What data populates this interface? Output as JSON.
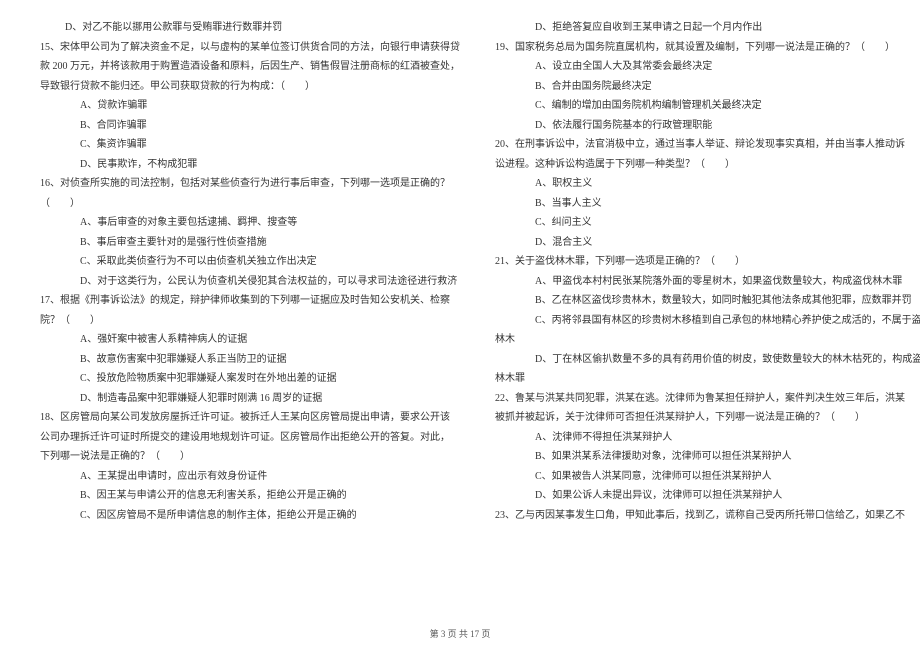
{
  "left_column": [
    {
      "cls": "indent-1",
      "text": "D、对乙不能以挪用公款罪与受贿罪进行数罪并罚"
    },
    {
      "cls": "q-continue",
      "text": "15、宋体甲公司为了解决资金不足，以与虚构的某单位签订供货合同的方法，向银行申请获得贷"
    },
    {
      "cls": "q-continue",
      "text": "款 200 万元，并将该款用于购置造酒设备和原料，后因生产、销售假冒注册商标的红酒被查处，"
    },
    {
      "cls": "q-continue",
      "text": "导致银行贷款不能归还。甲公司获取贷款的行为构成：（　　）"
    },
    {
      "cls": "indent-2",
      "text": "A、贷款诈骗罪"
    },
    {
      "cls": "indent-2",
      "text": "B、合同诈骗罪"
    },
    {
      "cls": "indent-2",
      "text": "C、集资诈骗罪"
    },
    {
      "cls": "indent-2",
      "text": "D、民事欺诈，不构成犯罪"
    },
    {
      "cls": "q-continue",
      "text": "16、对侦查所实施的司法控制，包括对某些侦查行为进行事后审查，下列哪一选项是正确的？"
    },
    {
      "cls": "q-continue",
      "text": "（　　）"
    },
    {
      "cls": "indent-2",
      "text": "A、事后审查的对象主要包括逮捕、羁押、搜查等"
    },
    {
      "cls": "indent-2",
      "text": "B、事后审查主要针对的是强行性侦查措施"
    },
    {
      "cls": "indent-2",
      "text": "C、采取此类侦查行为不可以由侦查机关独立作出决定"
    },
    {
      "cls": "indent-2",
      "text": "D、对于这类行为，公民认为侦查机关侵犯其合法权益的，可以寻求司法途径进行救济"
    },
    {
      "cls": "q-continue",
      "text": "17、根据《刑事诉讼法》的规定，辩护律师收集到的下列哪一证据应及时告知公安机关、检察"
    },
    {
      "cls": "q-continue",
      "text": "院？（　　）"
    },
    {
      "cls": "indent-2",
      "text": "A、强奸案中被害人系精神病人的证据"
    },
    {
      "cls": "indent-2",
      "text": "B、故意伤害案中犯罪嫌疑人系正当防卫的证据"
    },
    {
      "cls": "indent-2",
      "text": "C、投放危险物质案中犯罪嫌疑人案发时在外地出差的证据"
    },
    {
      "cls": "indent-2",
      "text": "D、制造毒品案中犯罪嫌疑人犯罪时刚满 16 周岁的证据"
    },
    {
      "cls": "q-continue",
      "text": "18、区房管局向某公司发放房屋拆迁许可证。被拆迁人王某向区房管局提出申请，要求公开该"
    },
    {
      "cls": "q-continue",
      "text": "公司办理拆迁许可证时所提交的建设用地规划许可证。区房管局作出拒绝公开的答复。对此，"
    },
    {
      "cls": "q-continue",
      "text": "下列哪一说法是正确的？（　　）"
    },
    {
      "cls": "indent-2",
      "text": "A、王某提出申请时，应出示有效身份证件"
    },
    {
      "cls": "indent-2",
      "text": "B、因王某与申请公开的信息无利害关系，拒绝公开是正确的"
    },
    {
      "cls": "indent-2",
      "text": "C、因区房管局不是所申请信息的制作主体，拒绝公开是正确的"
    }
  ],
  "right_column": [
    {
      "cls": "indent-2",
      "text": "D、拒绝答复应自收到王某申请之日起一个月内作出"
    },
    {
      "cls": "q-continue",
      "text": "19、国家税务总局为国务院直属机构，就其设置及编制，下列哪一说法是正确的？（　　）"
    },
    {
      "cls": "indent-2",
      "text": "A、设立由全国人大及其常委会最终决定"
    },
    {
      "cls": "indent-2",
      "text": "B、合并由国务院最终决定"
    },
    {
      "cls": "indent-2",
      "text": "C、编制的增加由国务院机构编制管理机关最终决定"
    },
    {
      "cls": "indent-2",
      "text": "D、依法履行国务院基本的行政管理职能"
    },
    {
      "cls": "q-continue",
      "text": "20、在刑事诉讼中，法官消极中立，通过当事人举证、辩论发现事实真相，并由当事人推动诉"
    },
    {
      "cls": "q-continue",
      "text": "讼进程。这种诉讼构造属于下列哪一种类型？（　　）"
    },
    {
      "cls": "indent-2",
      "text": "A、职权主义"
    },
    {
      "cls": "indent-2",
      "text": "B、当事人主义"
    },
    {
      "cls": "indent-2",
      "text": "C、纠问主义"
    },
    {
      "cls": "indent-2",
      "text": "D、混合主义"
    },
    {
      "cls": "q-continue",
      "text": "21、关于盗伐林木罪，下列哪一选项是正确的？（　　）"
    },
    {
      "cls": "indent-2",
      "text": "A、甲盗伐本村村民张某院落外面的零星树木，如果盗伐数量较大，构成盗伐林木罪"
    },
    {
      "cls": "indent-2",
      "text": "B、乙在林区盗伐珍贵林木，数量较大，如同时触犯其他法条成其他犯罪，应数罪并罚"
    },
    {
      "cls": "indent-2",
      "text": "C、丙将邻县国有林区的珍贵树木移植到自己承包的林地精心养护使之成活的，不属于盗伐"
    },
    {
      "cls": "q-continue",
      "text": "林木"
    },
    {
      "cls": "indent-2",
      "text": "D、丁在林区偷扒数量不多的具有药用价值的树皮，致使数量较大的林木枯死的，构成盗伐"
    },
    {
      "cls": "q-continue",
      "text": "林木罪"
    },
    {
      "cls": "q-continue",
      "text": "22、鲁某与洪某共同犯罪，洪某在逃。沈律师为鲁某担任辩护人，案件判决生效三年后，洪某"
    },
    {
      "cls": "q-continue",
      "text": "被抓并被起诉，关于沈律师可否担任洪某辩护人，下列哪一说法是正确的？（　　）"
    },
    {
      "cls": "indent-2",
      "text": "A、沈律师不得担任洪某辩护人"
    },
    {
      "cls": "indent-2",
      "text": "B、如果洪某系法律援助对象，沈律师可以担任洪某辩护人"
    },
    {
      "cls": "indent-2",
      "text": "C、如果被告人洪某同意，沈律师可以担任洪某辩护人"
    },
    {
      "cls": "indent-2",
      "text": "D、如果公诉人未提出异议，沈律师可以担任洪某辩护人"
    },
    {
      "cls": "q-continue",
      "text": "23、乙与丙因某事发生口角，甲知此事后，找到乙，谎称自己受丙所托带口信给乙，如果乙不"
    }
  ],
  "footer": "第 3 页 共 17 页"
}
